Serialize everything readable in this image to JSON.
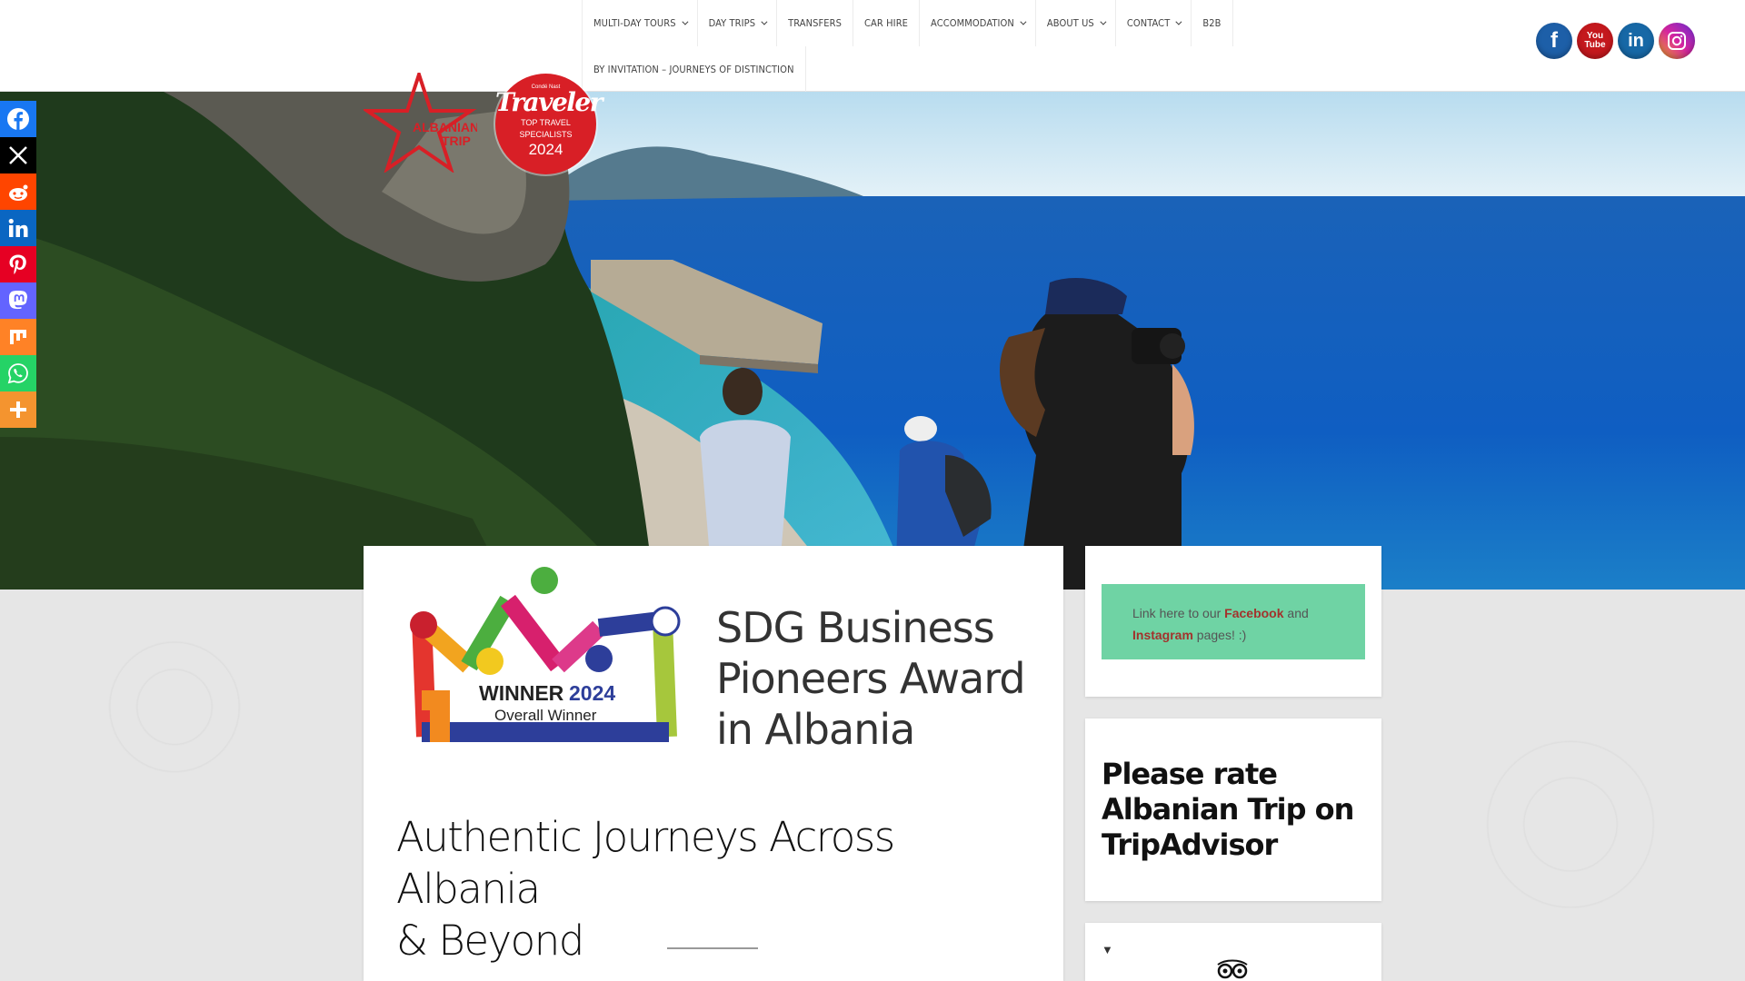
{
  "nav": {
    "row1": [
      {
        "label": "MULTI-DAY TOURS",
        "dropdown": true
      },
      {
        "label": "DAY TRIPS",
        "dropdown": true
      },
      {
        "label": "TRANSFERS",
        "dropdown": false
      },
      {
        "label": "CAR HIRE",
        "dropdown": false
      },
      {
        "label": "ACCOMMODATION",
        "dropdown": true
      },
      {
        "label": "ABOUT US",
        "dropdown": true
      },
      {
        "label": "CONTACT",
        "dropdown": true
      },
      {
        "label": "B2B",
        "dropdown": false
      }
    ],
    "row2": [
      {
        "label": "BY INVITATION – JOURNEYS OF DISTINCTION",
        "dropdown": false
      }
    ]
  },
  "social_top": {
    "facebook": "f",
    "youtube_top": "You",
    "youtube_bottom": "Tube",
    "linkedin": "in"
  },
  "share_bar": [
    {
      "icon": "facebook-icon",
      "color": "#1877f2"
    },
    {
      "icon": "x-icon",
      "color": "#000000"
    },
    {
      "icon": "reddit-icon",
      "color": "#ff4500"
    },
    {
      "icon": "linkedin-icon",
      "color": "#0a66c2"
    },
    {
      "icon": "pinterest-icon",
      "color": "#e60023"
    },
    {
      "icon": "mastodon-icon",
      "color": "#6364ff"
    },
    {
      "icon": "mix-icon",
      "color": "#ff8226"
    },
    {
      "icon": "whatsapp-icon",
      "color": "#25d366"
    },
    {
      "icon": "more-icon",
      "color": "#f4942f"
    }
  ],
  "logo": {
    "line1": "ALBANIAN",
    "line2": "TRIP"
  },
  "traveler_badge": {
    "small": "Condé Nast",
    "big": "Traveler",
    "line1": "TOP TRAVEL",
    "line2": "SPECIALISTS",
    "year": "2024"
  },
  "award": {
    "winner_label": "WINNER",
    "winner_year": "2024",
    "overall": "Overall Winner",
    "title_lines": [
      "SDG Business",
      "Pioneers Award",
      "in Albania"
    ]
  },
  "main_heading_lines": [
    "Authentic Journeys Across Albania",
    "& Beyond"
  ],
  "side_link_box": {
    "prefix": "Link here to our ",
    "facebook": "Facebook",
    "middle": " and",
    "instagram": "Instagram",
    "suffix": " pages! :)"
  },
  "rate_heading_lines": [
    "Please rate",
    "Albanian Trip on",
    "TripAdvisor"
  ],
  "collapse_arrow": "▼",
  "colors": {
    "green_box": "#6fd3a4",
    "link_red": "#a3322c",
    "badge_red": "#d81f26"
  }
}
